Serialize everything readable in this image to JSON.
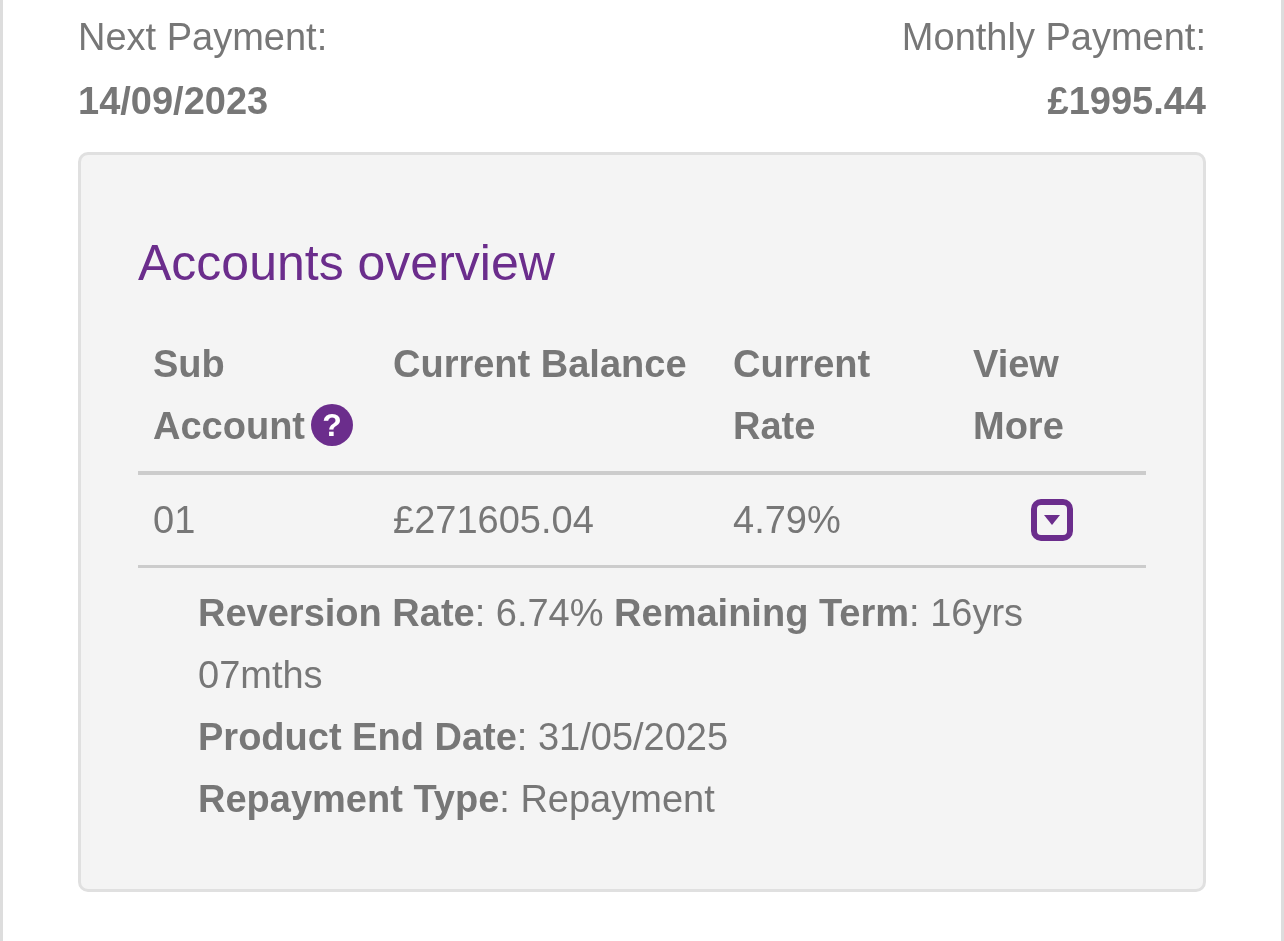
{
  "summary": [
    {
      "label": "Next Payment:",
      "value": "14/09/2023"
    },
    {
      "label": "Monthly Payment:",
      "value": "£1995.44"
    }
  ],
  "accounts": {
    "title": "Accounts overview",
    "columns": [
      {
        "label": "Sub Account",
        "help": "?"
      },
      {
        "label": "Current Balance"
      },
      {
        "label": "Current Rate"
      },
      {
        "label": "View More"
      }
    ],
    "rows": [
      {
        "cells": [
          "01",
          "£271605.04",
          "4.79%"
        ],
        "expanded": true,
        "details": [
          "**Reversion Rate**: 6.74% **Remaining Term**: 16yrs 07mths",
          "**Product End Date**: 31/05/2025",
          "**Repayment Type**: Repayment"
        ]
      }
    ]
  }
}
